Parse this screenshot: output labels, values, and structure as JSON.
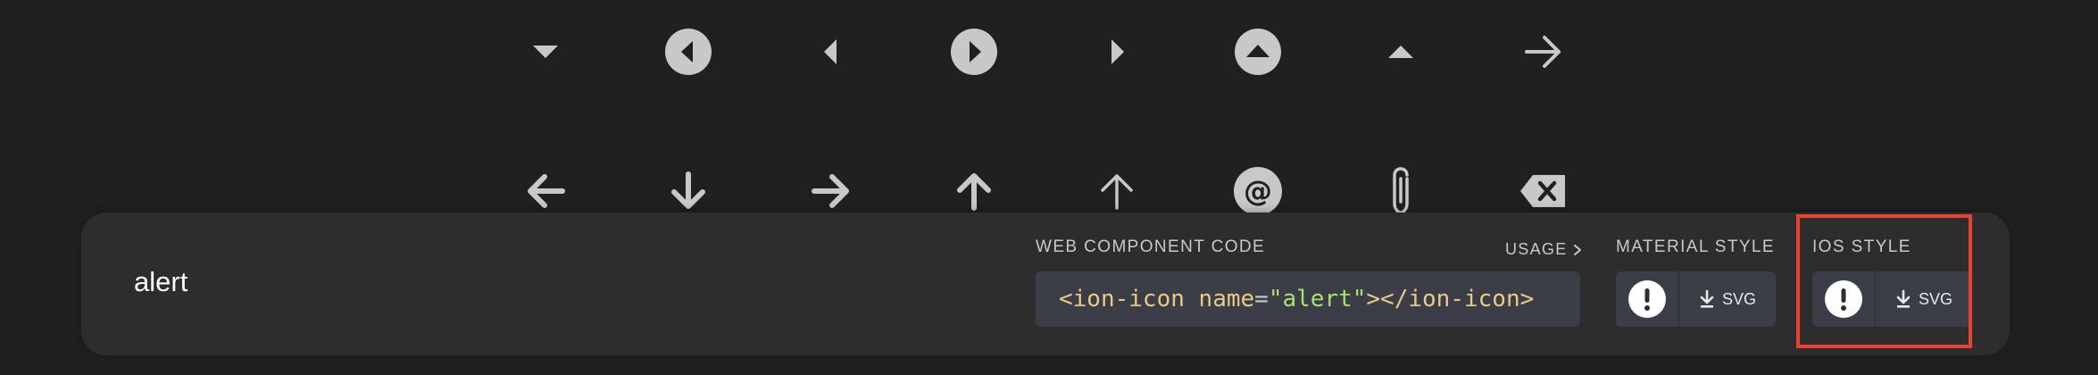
{
  "icon_grid": {
    "row1": [
      {
        "icon": "caret-down-icon"
      },
      {
        "icon": "caret-back-circle-icon"
      },
      {
        "icon": "caret-back-icon"
      },
      {
        "icon": "caret-forward-circle-icon"
      },
      {
        "icon": "caret-forward-icon"
      },
      {
        "icon": "caret-up-circle-icon"
      },
      {
        "icon": "caret-up-icon"
      },
      {
        "icon": "arrow-forward-icon"
      }
    ],
    "row2": [
      {
        "icon": "arrow-back-icon"
      },
      {
        "icon": "arrow-down-icon"
      },
      {
        "icon": "arrow-forward-icon"
      },
      {
        "icon": "arrow-up-icon"
      },
      {
        "icon": "arrow-up-outline-icon"
      },
      {
        "icon": "at-circle-icon"
      },
      {
        "icon": "attach-icon"
      },
      {
        "icon": "backspace-icon"
      }
    ]
  },
  "detail_panel": {
    "icon_name": "alert",
    "web_component": {
      "label": "WEB COMPONENT CODE",
      "usage_link": "USAGE",
      "code": {
        "open_tag": "<ion-icon",
        "attr_name": "name",
        "equals": "=",
        "attr_value": "\"alert\"",
        "close": "></ion-icon>"
      }
    },
    "material_style": {
      "label": "MATERIAL STYLE",
      "icon": "alert-circle-icon",
      "download_label": "SVG"
    },
    "ios_style": {
      "label": "IOS STYLE",
      "icon": "alert-circle-icon",
      "download_label": "SVG",
      "highlighted": true
    }
  },
  "colors": {
    "background": "#202020",
    "panel": "#2d2d2d",
    "icon": "#c8c8c8",
    "code_tag": "#e7c98a",
    "code_string": "#a6e26b",
    "highlight": "#e8432d"
  }
}
